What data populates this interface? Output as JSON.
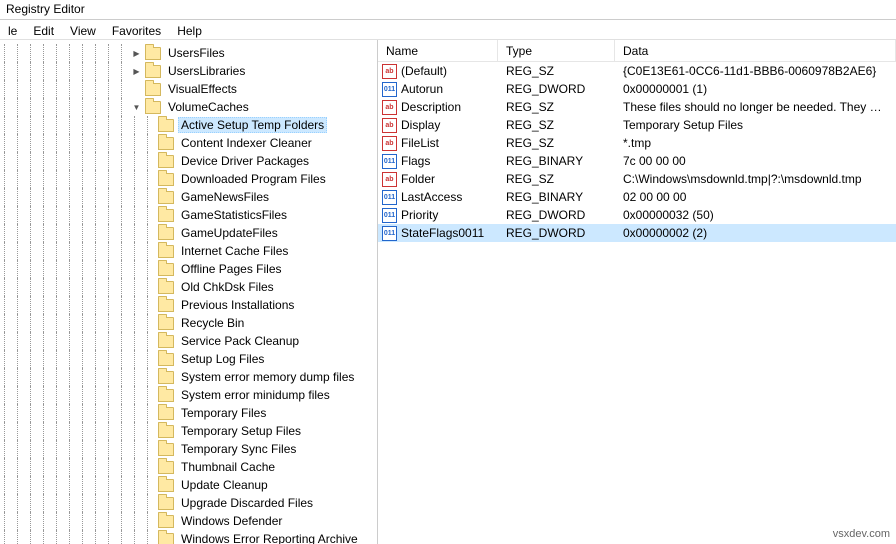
{
  "title": "Registry Editor",
  "menus": [
    "le",
    "Edit",
    "View",
    "Favorites",
    "Help"
  ],
  "list_headers": {
    "name": "Name",
    "type": "Type",
    "data": "Data"
  },
  "parent_nodes": [
    {
      "label": "UsersFiles",
      "exp": "▶"
    },
    {
      "label": "UsersLibraries",
      "exp": "▶"
    },
    {
      "label": "VisualEffects",
      "exp": ""
    },
    {
      "label": "VolumeCaches",
      "exp": "▼"
    }
  ],
  "tree_children": [
    {
      "label": "Active Setup Temp Folders",
      "selected": true
    },
    {
      "label": "Content Indexer Cleaner"
    },
    {
      "label": "Device Driver Packages"
    },
    {
      "label": "Downloaded Program Files"
    },
    {
      "label": "GameNewsFiles"
    },
    {
      "label": "GameStatisticsFiles"
    },
    {
      "label": "GameUpdateFiles"
    },
    {
      "label": "Internet Cache Files"
    },
    {
      "label": "Offline Pages Files"
    },
    {
      "label": "Old ChkDsk Files"
    },
    {
      "label": "Previous Installations"
    },
    {
      "label": "Recycle Bin"
    },
    {
      "label": "Service Pack Cleanup"
    },
    {
      "label": "Setup Log Files"
    },
    {
      "label": "System error memory dump files"
    },
    {
      "label": "System error minidump files"
    },
    {
      "label": "Temporary Files"
    },
    {
      "label": "Temporary Setup Files"
    },
    {
      "label": "Temporary Sync Files"
    },
    {
      "label": "Thumbnail Cache"
    },
    {
      "label": "Update Cleanup"
    },
    {
      "label": "Upgrade Discarded Files"
    },
    {
      "label": "Windows Defender"
    },
    {
      "label": "Windows Error Reporting Archive"
    }
  ],
  "values": [
    {
      "name": "(Default)",
      "type": "REG_SZ",
      "data": "{C0E13E61-0CC6-11d1-BBB6-0060978B2AE6}",
      "icon": "str"
    },
    {
      "name": "Autorun",
      "type": "REG_DWORD",
      "data": "0x00000001 (1)",
      "icon": "bin"
    },
    {
      "name": "Description",
      "type": "REG_SZ",
      "data": "These files should no longer be needed. They wer...",
      "icon": "str"
    },
    {
      "name": "Display",
      "type": "REG_SZ",
      "data": "Temporary Setup Files",
      "icon": "str"
    },
    {
      "name": "FileList",
      "type": "REG_SZ",
      "data": "*.tmp",
      "icon": "str"
    },
    {
      "name": "Flags",
      "type": "REG_BINARY",
      "data": "7c 00 00 00",
      "icon": "bin"
    },
    {
      "name": "Folder",
      "type": "REG_SZ",
      "data": "C:\\Windows\\msdownld.tmp|?:\\msdownld.tmp",
      "icon": "str"
    },
    {
      "name": "LastAccess",
      "type": "REG_BINARY",
      "data": "02 00 00 00",
      "icon": "bin"
    },
    {
      "name": "Priority",
      "type": "REG_DWORD",
      "data": "0x00000032 (50)",
      "icon": "bin"
    },
    {
      "name": "StateFlags0011",
      "type": "REG_DWORD",
      "data": "0x00000002 (2)",
      "icon": "bin",
      "selected": true
    }
  ],
  "watermark": "vsxdev.com"
}
